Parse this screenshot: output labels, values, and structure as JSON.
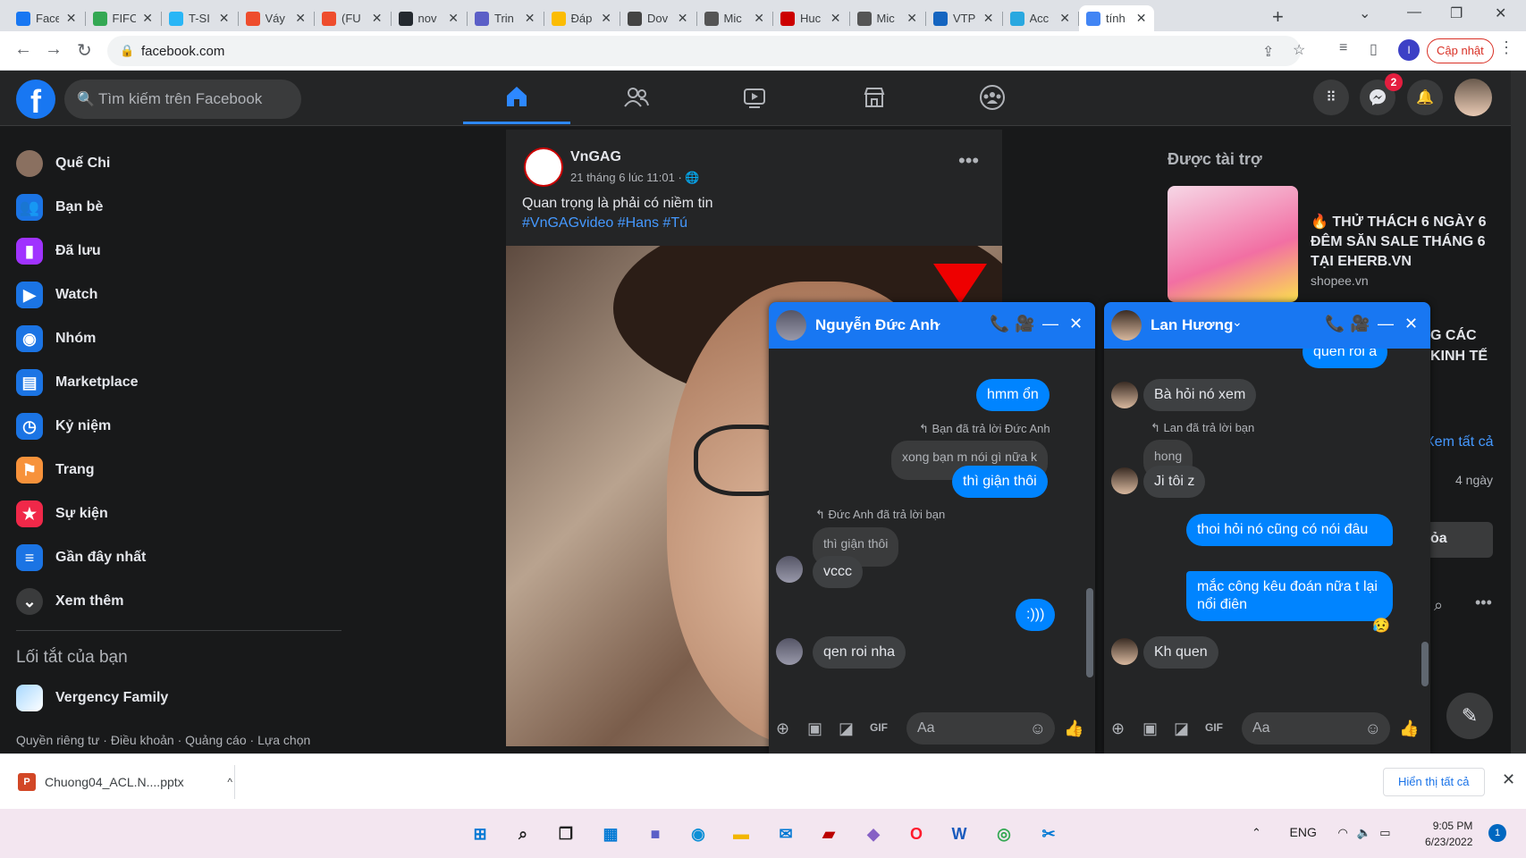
{
  "browser": {
    "tabs": [
      {
        "title": "Face",
        "color": "#1877f2"
      },
      {
        "title": "FIFC",
        "color": "#34a853"
      },
      {
        "title": "T-SI",
        "color": "#29b6f6"
      },
      {
        "title": "Váy",
        "color": "#ee4d2d"
      },
      {
        "title": "(FU",
        "color": "#ee4d2d"
      },
      {
        "title": "nov",
        "color": "#24292f"
      },
      {
        "title": "Trin",
        "color": "#5b5fc7"
      },
      {
        "title": "Đáp",
        "color": "#fbbc04"
      },
      {
        "title": "Dov",
        "color": "#444"
      },
      {
        "title": "Mic",
        "color": "#555"
      },
      {
        "title": "Huc",
        "color": "#c00"
      },
      {
        "title": "Mic",
        "color": "#555"
      },
      {
        "title": "VTP",
        "color": "#1565c0"
      },
      {
        "title": "Acc",
        "color": "#29a8e0"
      },
      {
        "title": "tính",
        "color": "#4285f4"
      }
    ],
    "url": "facebook.com",
    "update_label": "Cập nhật",
    "profile_initial": "I"
  },
  "fb": {
    "search_placeholder": "Tìm kiếm trên Facebook",
    "messenger_badge": "2"
  },
  "sidebar": {
    "items": [
      {
        "label": "Quế Chi",
        "icon": "user-avatar",
        "color": "#8a7060"
      },
      {
        "label": "Bạn bè",
        "icon": "friends-icon",
        "color": "#1b74e4"
      },
      {
        "label": "Đã lưu",
        "icon": "bookmark-icon",
        "color": "#a033ff"
      },
      {
        "label": "Watch",
        "icon": "watch-icon",
        "color": "#1b74e4"
      },
      {
        "label": "Nhóm",
        "icon": "groups-icon",
        "color": "#1b74e4"
      },
      {
        "label": "Marketplace",
        "icon": "marketplace-icon",
        "color": "#1b74e4"
      },
      {
        "label": "Kỷ niệm",
        "icon": "memories-icon",
        "color": "#1b74e4"
      },
      {
        "label": "Trang",
        "icon": "flag-icon",
        "color": "#f7923b"
      },
      {
        "label": "Sự kiện",
        "icon": "events-icon",
        "color": "#f02849"
      },
      {
        "label": "Gần đây nhất",
        "icon": "feeds-icon",
        "color": "#1b74e4"
      },
      {
        "label": "Xem thêm",
        "icon": "chevron-down-icon",
        "color": "#3a3b3c"
      }
    ],
    "shortcuts_title": "Lối tắt của bạn",
    "shortcut": "Vergency Family",
    "footer": "Quyền riêng tư · Điều khoản · Quảng cáo · Lựa chọn"
  },
  "post": {
    "author": "VnGAG",
    "time": "21 tháng 6 lúc 11:01 · 🌐",
    "text": "Quan trọng là phải có niềm tin",
    "tags": "#VnGAGvideo #Hans #Tú"
  },
  "right": {
    "sponsored": "Được tài trợ",
    "ad_title": "🔥 THỬ THÁCH 6 NGÀY 6 ĐÊM SĂN SALE THÁNG 6 TẠI EHERB.VN",
    "ad_domain": "shopee.vn",
    "frag1": "G CÁC",
    "frag2": "KINH TẾ",
    "see_all": "Xem tất cả",
    "days": "4 ngày",
    "frag3": "ỏa"
  },
  "chat1": {
    "name": "Nguyễn Đức Anh",
    "reply1": "↰ Bạn đã trả lời Đức Anh",
    "reply2": "↰ Đức Anh đã trả lời bạn",
    "m1": "hmm ổn",
    "q1": "xong bạn m nói gì nữa k",
    "m2": "thì giận thôi",
    "q2": "thì giận thôi",
    "m3": "vccc",
    "m4": ":)))",
    "m5": "qen roi nha",
    "input_placeholder": "Aa"
  },
  "chat2": {
    "name": "Lan Hương",
    "top": "quen roi á",
    "m1": "Bà hỏi nó xem",
    "reply1": "↰ Lan đã trả lời bạn",
    "q1": "hong",
    "m2": "Ji tôi z",
    "m3": "thoi hỏi nó cũng có nói đâu",
    "m4": "mắc công kêu đoán nữa t lại nổi điên",
    "reaction": "😥",
    "m5": "Kh quen",
    "input_placeholder": "Aa"
  },
  "download": {
    "file": "Chuong04_ACL.N....pptx",
    "show_all": "Hiển thị tất cả"
  },
  "taskbar": {
    "lang": "ENG",
    "time": "9:05 PM",
    "date": "6/23/2022",
    "notif": "1"
  }
}
